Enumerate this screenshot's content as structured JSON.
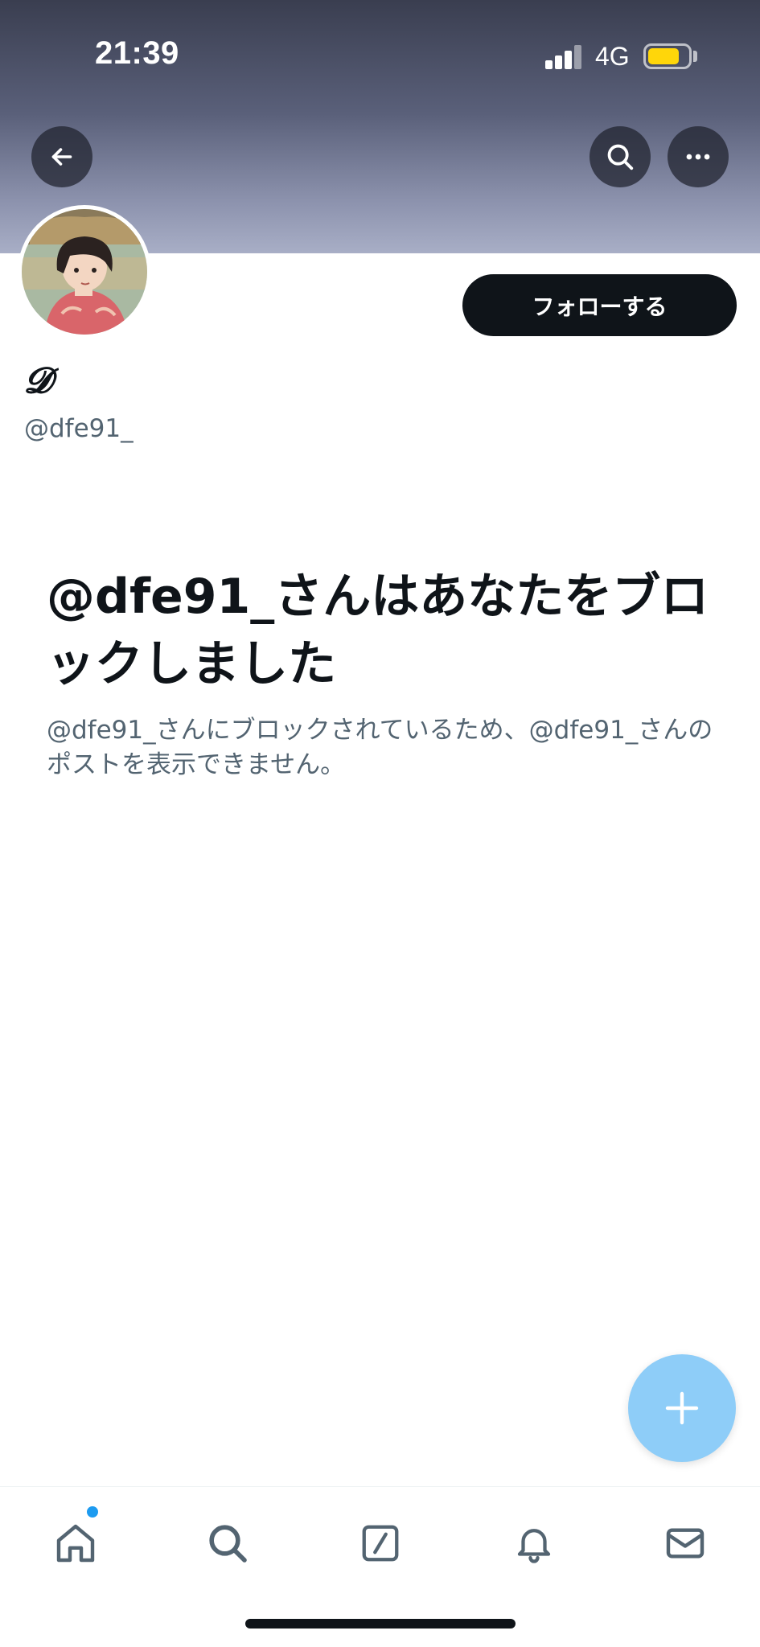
{
  "status_bar": {
    "time": "21:39",
    "network": "4G",
    "battery_color": "#ffd60a"
  },
  "header": {
    "back_icon": "arrow-left-icon",
    "search_icon": "search-icon",
    "more_icon": "more-horizontal-icon"
  },
  "profile": {
    "display_name": "𝓓",
    "handle": "@dfe91_",
    "follow_label": "フォローする"
  },
  "blocked": {
    "title": "@dfe91_さんはあなたをブロックしました",
    "description": "@dfe91_さんにブロックされているため、@dfe91_さんのポストを表示できません。"
  },
  "fab": {
    "icon": "plus-icon",
    "color": "#8ecdf8"
  },
  "bottom_nav": {
    "items": [
      "home-icon",
      "search-icon",
      "grok-icon",
      "bell-icon",
      "mail-icon"
    ],
    "unread_dot_color": "#1d9bf0"
  }
}
